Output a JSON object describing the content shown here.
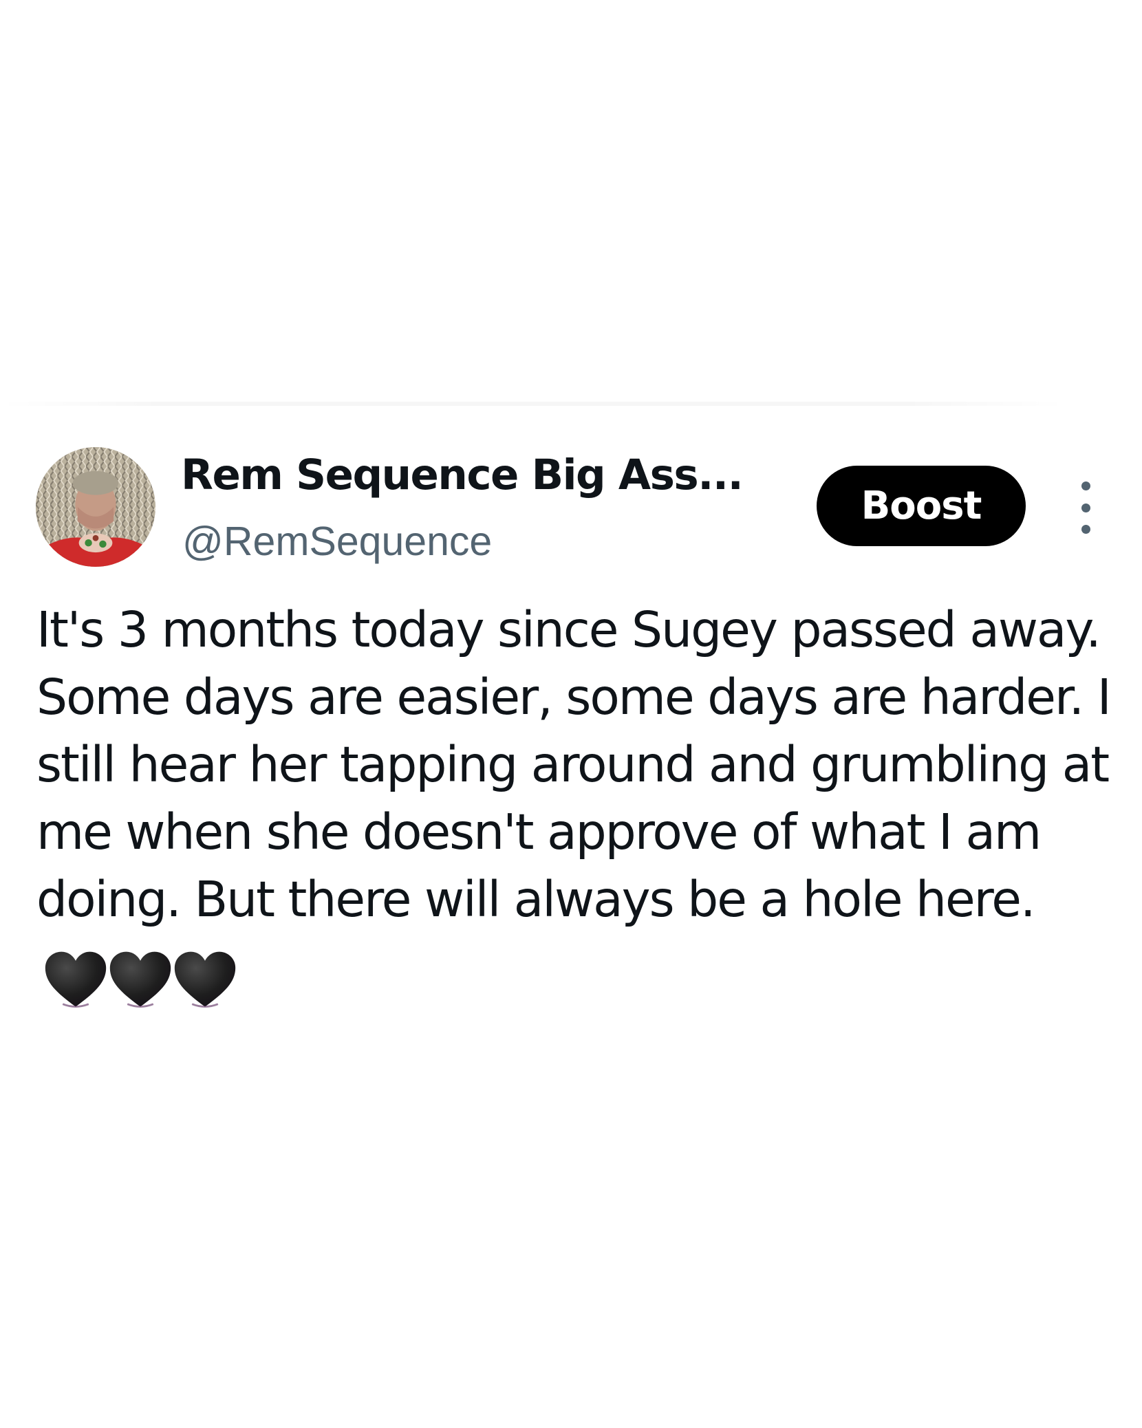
{
  "post": {
    "display_name": "Rem Sequence Big Ass...",
    "handle": "@RemSequence",
    "boost_label": "Boost",
    "more_icon": "more-vertical-icon",
    "text": "It's 3 months today since Sugey passed away. Some days are easier, some days are harder. I still hear her tapping around and grumbling at me when she doesn't approve of what I am doing. But there will always be a hole here.",
    "emoji": [
      "black-heart",
      "black-heart",
      "black-heart"
    ],
    "emoji_color": "#1c1c1c"
  },
  "colors": {
    "text_primary": "#0f1419",
    "text_secondary": "#536471",
    "button_bg": "#000000",
    "button_text": "#ffffff",
    "background": "#ffffff"
  }
}
